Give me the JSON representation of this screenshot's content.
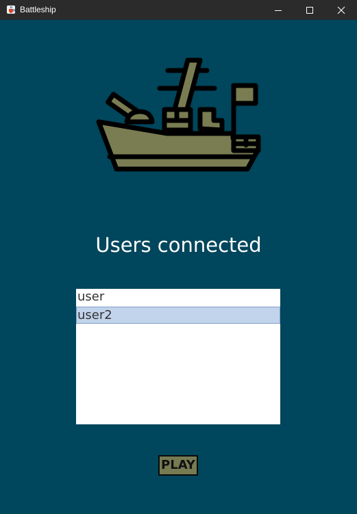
{
  "window": {
    "title": "Battleship",
    "app_icon": "java-cup-icon",
    "controls": [
      "minimize-icon",
      "maximize-icon",
      "close-icon"
    ]
  },
  "logo": {
    "icon": "battleship-icon",
    "hull_color": "#7A7D52",
    "outline_color": "#000000"
  },
  "main": {
    "heading": "Users connected",
    "users": [
      {
        "label": "user",
        "selected": false
      },
      {
        "label": "user2",
        "selected": true
      }
    ],
    "play_label": "PLAY"
  },
  "colors": {
    "background": "#00465C",
    "titlebar": "#2B2B2B",
    "selection": "#C2D3EC",
    "button": "#777B52"
  }
}
